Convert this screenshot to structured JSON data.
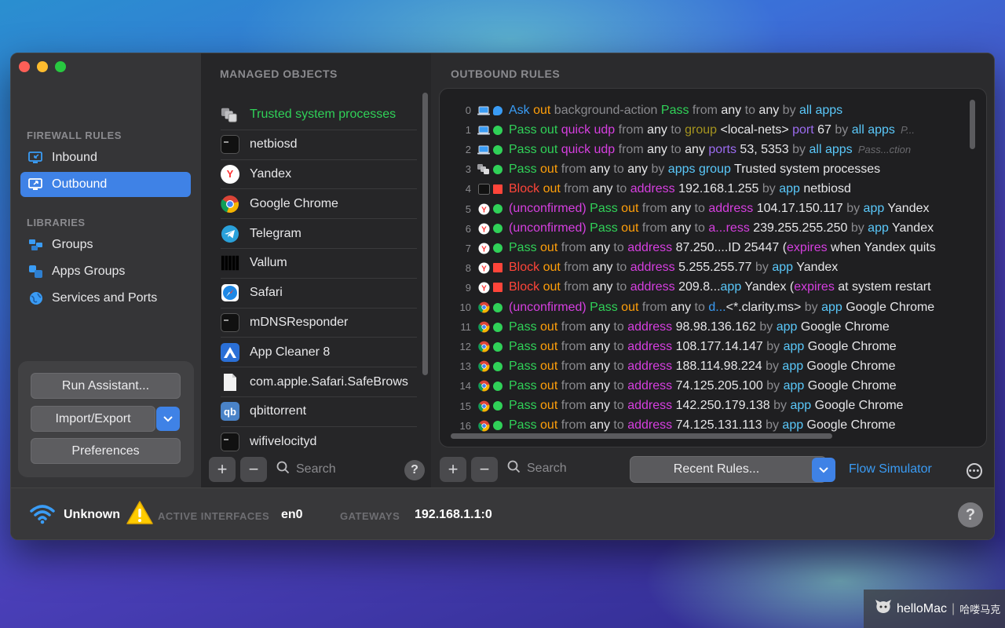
{
  "sidebar": {
    "firewall_rules_label": "FIREWALL RULES",
    "items": [
      {
        "label": "Inbound",
        "icon": "inbound-icon"
      },
      {
        "label": "Outbound",
        "icon": "outbound-icon"
      }
    ],
    "libraries_label": "LIBRARIES",
    "library_items": [
      {
        "label": "Groups",
        "icon": "groups-icon"
      },
      {
        "label": "Apps Groups",
        "icon": "apps-groups-icon"
      },
      {
        "label": "Services and Ports",
        "icon": "globe-icon"
      }
    ],
    "run_assistant": "Run Assistant...",
    "import_export": "Import/Export",
    "preferences": "Preferences"
  },
  "managed": {
    "title": "MANAGED OBJECTS",
    "items": [
      {
        "label": "Trusted system processes",
        "icon": "system-processes-icon",
        "highlight": true
      },
      {
        "label": "netbiosd",
        "icon": "terminal-icon"
      },
      {
        "label": "Yandex",
        "icon": "yandex-icon"
      },
      {
        "label": "Google Chrome",
        "icon": "chrome-icon"
      },
      {
        "label": "Telegram",
        "icon": "telegram-icon"
      },
      {
        "label": "Vallum",
        "icon": "vallum-icon"
      },
      {
        "label": "Safari",
        "icon": "safari-icon"
      },
      {
        "label": "mDNSResponder",
        "icon": "terminal-icon"
      },
      {
        "label": "App Cleaner 8",
        "icon": "app-cleaner-icon"
      },
      {
        "label": "com.apple.Safari.SafeBrows",
        "icon": "document-icon"
      },
      {
        "label": "qbittorrent",
        "icon": "qbittorrent-icon"
      },
      {
        "label": "wifivelocityd",
        "icon": "terminal-icon"
      }
    ],
    "search_placeholder": "Search"
  },
  "outbound": {
    "title": "OUTBOUND RULES",
    "rules": [
      {
        "num": "0",
        "app": "laptop",
        "dot": "blue-bubble",
        "parts": [
          [
            "Ask",
            "blue"
          ],
          [
            " out",
            "orange"
          ],
          [
            " background-action",
            "grey"
          ],
          [
            " Pass",
            "green"
          ],
          [
            " from",
            "grey"
          ],
          [
            " any",
            "white"
          ],
          [
            " to",
            "grey"
          ],
          [
            " any",
            "white"
          ],
          [
            " by",
            "grey"
          ],
          [
            " all apps",
            "cyan"
          ]
        ]
      },
      {
        "num": "1",
        "app": "laptop",
        "dot": "green",
        "parts": [
          [
            "Pass out",
            "green"
          ],
          [
            " quick udp",
            "magenta"
          ],
          [
            " from",
            "grey"
          ],
          [
            " any",
            "white"
          ],
          [
            " to",
            "grey"
          ],
          [
            " group",
            "olive"
          ],
          [
            " <local-nets>",
            "white"
          ],
          [
            " port",
            "purple"
          ],
          [
            " 67",
            "white"
          ],
          [
            " by",
            "grey"
          ],
          [
            " all apps",
            "cyan"
          ],
          [
            "  P...",
            "dim"
          ]
        ]
      },
      {
        "num": "2",
        "app": "laptop",
        "dot": "green",
        "parts": [
          [
            "Pass out",
            "green"
          ],
          [
            " quick udp",
            "magenta"
          ],
          [
            " from",
            "grey"
          ],
          [
            " any",
            "white"
          ],
          [
            " to",
            "grey"
          ],
          [
            " any",
            "white"
          ],
          [
            " ports",
            "purple"
          ],
          [
            " 53, 5353",
            "white"
          ],
          [
            " by",
            "grey"
          ],
          [
            " all apps",
            "cyan"
          ],
          [
            "  Pass...ction",
            "dim"
          ]
        ]
      },
      {
        "num": "3",
        "app": "system",
        "dot": "green",
        "parts": [
          [
            "Pass",
            "green"
          ],
          [
            " out",
            "orange"
          ],
          [
            " from",
            "grey"
          ],
          [
            " any",
            "white"
          ],
          [
            " to",
            "grey"
          ],
          [
            " any",
            "white"
          ],
          [
            " by",
            "grey"
          ],
          [
            " apps group",
            "cyan"
          ],
          [
            " Trusted system processes",
            "white"
          ]
        ]
      },
      {
        "num": "4",
        "app": "terminal",
        "dot": "red-sq",
        "parts": [
          [
            "Block",
            "red"
          ],
          [
            " out",
            "orange"
          ],
          [
            " from",
            "grey"
          ],
          [
            " any",
            "white"
          ],
          [
            " to",
            "grey"
          ],
          [
            " address",
            "magenta"
          ],
          [
            " 192.168.1.255",
            "white"
          ],
          [
            " by",
            "grey"
          ],
          [
            " app",
            "cyan"
          ],
          [
            " netbiosd",
            "white"
          ]
        ]
      },
      {
        "num": "5",
        "app": "yandex",
        "dot": "green",
        "parts": [
          [
            "(unconfirmed)",
            "magenta"
          ],
          [
            " Pass",
            "green"
          ],
          [
            " out",
            "orange"
          ],
          [
            " from",
            "grey"
          ],
          [
            " any",
            "white"
          ],
          [
            " to",
            "grey"
          ],
          [
            " address",
            "magenta"
          ],
          [
            " 104.17.150.117",
            "white"
          ],
          [
            " by",
            "grey"
          ],
          [
            " app",
            "cyan"
          ],
          [
            " Yandex",
            "white"
          ]
        ]
      },
      {
        "num": "6",
        "app": "yandex",
        "dot": "green",
        "parts": [
          [
            "(unconfirmed)",
            "magenta"
          ],
          [
            " Pass",
            "green"
          ],
          [
            " out",
            "orange"
          ],
          [
            " from",
            "grey"
          ],
          [
            " any",
            "white"
          ],
          [
            " to",
            "grey"
          ],
          [
            " a...ress",
            "magenta"
          ],
          [
            " 239.255.255.250",
            "white"
          ],
          [
            " by",
            "grey"
          ],
          [
            " app",
            "cyan"
          ],
          [
            " Yandex",
            "white"
          ]
        ]
      },
      {
        "num": "7",
        "app": "yandex",
        "dot": "green",
        "parts": [
          [
            "Pass",
            "green"
          ],
          [
            " out",
            "orange"
          ],
          [
            " from",
            "grey"
          ],
          [
            " any",
            "white"
          ],
          [
            " to",
            "grey"
          ],
          [
            " address",
            "magenta"
          ],
          [
            " 87.250....ID 25447",
            "white"
          ],
          [
            " (",
            "white"
          ],
          [
            "expires",
            "magenta"
          ],
          [
            " when Yandex quits",
            "white"
          ]
        ]
      },
      {
        "num": "8",
        "app": "yandex",
        "dot": "red-sq",
        "parts": [
          [
            "Block",
            "red"
          ],
          [
            " out",
            "orange"
          ],
          [
            " from",
            "grey"
          ],
          [
            " any",
            "white"
          ],
          [
            " to",
            "grey"
          ],
          [
            " address",
            "magenta"
          ],
          [
            " 5.255.255.77",
            "white"
          ],
          [
            " by",
            "grey"
          ],
          [
            " app",
            "cyan"
          ],
          [
            " Yandex",
            "white"
          ]
        ]
      },
      {
        "num": "9",
        "app": "yandex",
        "dot": "red-sq",
        "parts": [
          [
            "Block",
            "red"
          ],
          [
            " out",
            "orange"
          ],
          [
            " from",
            "grey"
          ],
          [
            " any",
            "white"
          ],
          [
            " to",
            "grey"
          ],
          [
            " address",
            "magenta"
          ],
          [
            " 209.8...",
            "white"
          ],
          [
            "app",
            "cyan"
          ],
          [
            " Yandex (",
            "white"
          ],
          [
            "expires",
            "magenta"
          ],
          [
            " at system restart",
            "white"
          ]
        ]
      },
      {
        "num": "10",
        "app": "chrome",
        "dot": "green",
        "parts": [
          [
            "(unconfirmed)",
            "magenta"
          ],
          [
            " Pass",
            "green"
          ],
          [
            " out",
            "orange"
          ],
          [
            " from",
            "grey"
          ],
          [
            " any",
            "white"
          ],
          [
            " to",
            "grey"
          ],
          [
            " d...",
            "blue"
          ],
          [
            "<*.clarity.ms>",
            "white"
          ],
          [
            " by",
            "grey"
          ],
          [
            " app",
            "cyan"
          ],
          [
            " Google Chrome",
            "white"
          ]
        ]
      },
      {
        "num": "11",
        "app": "chrome",
        "dot": "green",
        "parts": [
          [
            "Pass",
            "green"
          ],
          [
            " out",
            "orange"
          ],
          [
            " from",
            "grey"
          ],
          [
            " any",
            "white"
          ],
          [
            " to",
            "grey"
          ],
          [
            " address",
            "magenta"
          ],
          [
            " 98.98.136.162",
            "white"
          ],
          [
            " by",
            "grey"
          ],
          [
            " app",
            "cyan"
          ],
          [
            " Google Chrome",
            "white"
          ]
        ]
      },
      {
        "num": "12",
        "app": "chrome",
        "dot": "green",
        "parts": [
          [
            "Pass",
            "green"
          ],
          [
            " out",
            "orange"
          ],
          [
            " from",
            "grey"
          ],
          [
            " any",
            "white"
          ],
          [
            " to",
            "grey"
          ],
          [
            " address",
            "magenta"
          ],
          [
            " 108.177.14.147",
            "white"
          ],
          [
            " by",
            "grey"
          ],
          [
            " app",
            "cyan"
          ],
          [
            " Google Chrome",
            "white"
          ]
        ]
      },
      {
        "num": "13",
        "app": "chrome",
        "dot": "green",
        "parts": [
          [
            "Pass",
            "green"
          ],
          [
            " out",
            "orange"
          ],
          [
            " from",
            "grey"
          ],
          [
            " any",
            "white"
          ],
          [
            " to",
            "grey"
          ],
          [
            " address",
            "magenta"
          ],
          [
            " 188.114.98.224",
            "white"
          ],
          [
            " by",
            "grey"
          ],
          [
            " app",
            "cyan"
          ],
          [
            " Google Chrome",
            "white"
          ]
        ]
      },
      {
        "num": "14",
        "app": "chrome",
        "dot": "green",
        "parts": [
          [
            "Pass",
            "green"
          ],
          [
            " out",
            "orange"
          ],
          [
            " from",
            "grey"
          ],
          [
            " any",
            "white"
          ],
          [
            " to",
            "grey"
          ],
          [
            " address",
            "magenta"
          ],
          [
            " 74.125.205.100",
            "white"
          ],
          [
            " by",
            "grey"
          ],
          [
            " app",
            "cyan"
          ],
          [
            " Google Chrome",
            "white"
          ]
        ]
      },
      {
        "num": "15",
        "app": "chrome",
        "dot": "green",
        "parts": [
          [
            "Pass",
            "green"
          ],
          [
            " out",
            "orange"
          ],
          [
            " from",
            "grey"
          ],
          [
            " any",
            "white"
          ],
          [
            " to",
            "grey"
          ],
          [
            " address",
            "magenta"
          ],
          [
            " 142.250.179.138",
            "white"
          ],
          [
            " by",
            "grey"
          ],
          [
            " app",
            "cyan"
          ],
          [
            " Google Chrome",
            "white"
          ]
        ]
      },
      {
        "num": "16",
        "app": "chrome",
        "dot": "green",
        "parts": [
          [
            "Pass",
            "green"
          ],
          [
            " out",
            "orange"
          ],
          [
            " from",
            "grey"
          ],
          [
            " any",
            "white"
          ],
          [
            " to",
            "grey"
          ],
          [
            " address",
            "magenta"
          ],
          [
            " 74.125.131.113",
            "white"
          ],
          [
            " by",
            "grey"
          ],
          [
            " app",
            "cyan"
          ],
          [
            " Google Chrome",
            "white"
          ]
        ]
      }
    ],
    "search_placeholder": "Search",
    "recent_rules": "Recent Rules...",
    "flow_simulator": "Flow Simulator"
  },
  "status": {
    "network_name": "Unknown",
    "active_interfaces_label": "ACTIVE INTERFACES",
    "active_interfaces_value": "en0",
    "gateways_label": "GATEWAYS",
    "gateways_value": "192.168.1.1:0"
  },
  "watermark": {
    "brand": "helloMac",
    "sep": "|",
    "cn": "哈喽马克"
  },
  "colors": {
    "accent": "#3f82e6",
    "pass": "#30d158",
    "block": "#ff453a",
    "out": "#ff9f0a",
    "address": "#d63fe0",
    "app": "#5ac8fa"
  }
}
